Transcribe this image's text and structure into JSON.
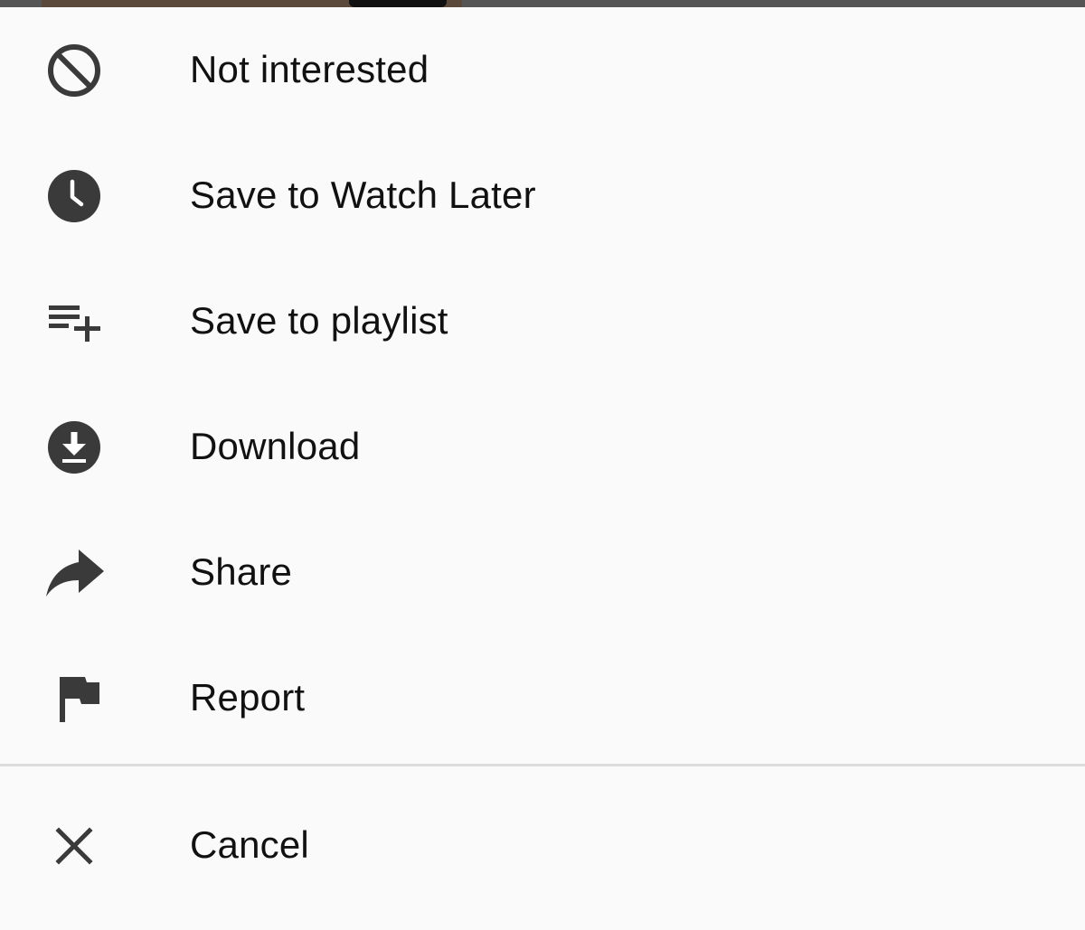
{
  "colors": {
    "background": "#fafafa",
    "text": "#111111",
    "icon": "#3a3a3a",
    "divider": "#dcdcdc"
  },
  "menu": {
    "items": [
      {
        "label": "Not interested",
        "icon": "block-icon"
      },
      {
        "label": "Save to Watch Later",
        "icon": "clock-icon"
      },
      {
        "label": "Save to playlist",
        "icon": "playlist-add-icon"
      },
      {
        "label": "Download",
        "icon": "download-icon"
      },
      {
        "label": "Share",
        "icon": "share-icon"
      },
      {
        "label": "Report",
        "icon": "flag-icon"
      }
    ],
    "cancel": {
      "label": "Cancel",
      "icon": "close-icon"
    }
  }
}
